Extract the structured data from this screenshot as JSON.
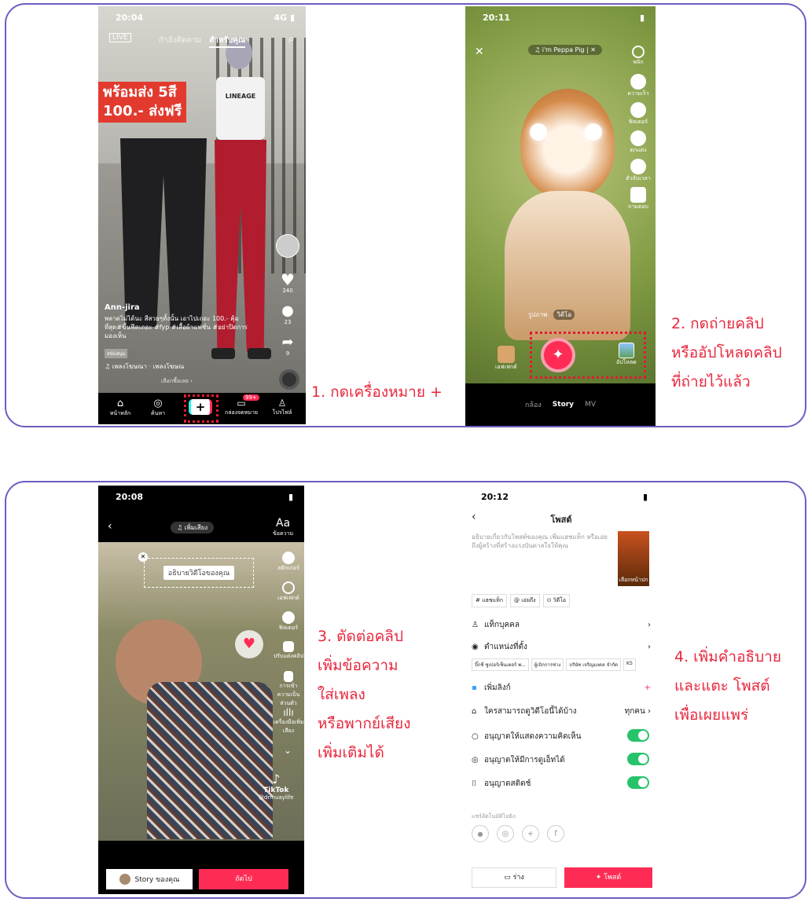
{
  "colors": {
    "border": "#6f5cc2",
    "step_text": "#e8273d",
    "tiktok_red": "#fe2c55",
    "toggle_green": "#27c36a"
  },
  "steps": [
    "1. กดเครื่องหมาย +",
    "2. กดถ่ายคลิป\nหรืออัปโหลดคลิป\nที่ถ่ายไว้แล้ว",
    "3. ตัดต่อคลิป\nเพิ่มข้อความ\nใส่เพลง\nหรือพากย์เสียง\nเพิ่มเติมได้",
    "4. เพิ่มคำอธิบาย\nและแตะ โพสต์\nเพื่อเผยแพร่"
  ],
  "screen1": {
    "time": "20:04",
    "net": "4G",
    "tab_following": "กำลังติดตาม",
    "tab_foryou": "สำหรับคุณ",
    "banner_line1": "พร้อมส่ง 5สี",
    "banner_line2": "100.- ส่งฟรี",
    "shirt_text": "LINEAGE",
    "likes": "240",
    "comments": "23",
    "shares": "9",
    "username": "Ann-jira",
    "caption": "พลาดไม่ได้นะ สีสวยๆทั้งนั้น เอาไปเถอะ 100.- คุ้มที่สุด#ขึ้นฟีดเถอะ #fyp #เสื้อผ้าแฟชั่น #อย่าปิดการมองเห็น",
    "tag": "สนับสนุน",
    "music": "เพลงโฆษณา · เพลงโฆษณ",
    "see_more": "เลือกซื้อเลย ›",
    "nav": [
      "หน้าหลัก",
      "ค้นหา",
      "+",
      "กล่องจดหมาย",
      "โปรไฟล์"
    ],
    "inbox_badge": "99+"
  },
  "screen2": {
    "time": "20:11",
    "sound": "i'm Peppa Pig",
    "rail": [
      "พลิก",
      "ความเร็ว",
      "ฟิลเตอร์",
      "ตกแต่ง",
      "ตัวจับเวลา",
      "ถามตอบ"
    ],
    "modes": [
      "รูปภาพ",
      "วิดีโอ"
    ],
    "effects_label": "เอฟเฟกต์",
    "upload_label": "อัปโหลด",
    "bottom_tabs": [
      "กล้อง",
      "Story",
      "MV"
    ]
  },
  "screen3": {
    "time": "20:08",
    "add_sound": "เพิ่มเสียง",
    "text_tool": "Aa",
    "rail": [
      "ข้อความ",
      "สติกเกอร์",
      "เอฟเฟกต์",
      "ฟิลเตอร์",
      "ปรับแต่งคลิป",
      "การเข้าความเป็นส่วนตัว",
      "เครื่องมือเพิ่มเสียง"
    ],
    "caption_placeholder": "อธิบายวิดีโอของคุณ",
    "watermark_brand": "TikTok",
    "watermark_user": "@drmuaylife",
    "story_btn": "Story ของคุณ",
    "next_btn": "ถัดไป"
  },
  "screen4": {
    "time": "20:12",
    "title": "โพสต์",
    "desc_placeholder": "อธิบายเกี่ยวกับโพสต์ของคุณ เพิ่มแฮชแท็ก หรือเอ่ยถึงผู้สร้างที่สร้างแรงบันดาลใจให้คุณ",
    "cover_label": "เลือกหน้าปก",
    "chips": [
      "# แฮชแท็ก",
      "@ เอ่ยถึง",
      "⊙ วิดีโอ"
    ],
    "tag_people": "แท็กบุคคล",
    "location": "ตำแหน่งที่ตั้ง",
    "loc_chips": [
      "บิ๊กซี ซูเปอร์เซ็นเตอร์ พ...",
      "ผู้เบิกการช่าง",
      "บริษัท เจริญมงคล จำกัด",
      "KS"
    ],
    "add_link": "เพิ่มลิงก์",
    "who_can_watch": "ใครสามารถดูวิดีโอนี้ได้บ้าง",
    "everyone": "ทุกคน",
    "allow_comments": "อนุญาตให้แสดงความคิดเห็น",
    "allow_duet": "อนุญาตให้มีการดูเอ็ทได้",
    "allow_stitch": "อนุญาตสติตช์",
    "share_to": "แชร์อัตโนมัติไปยัง:",
    "draft": "ร่าง",
    "post": "โพสต์"
  }
}
